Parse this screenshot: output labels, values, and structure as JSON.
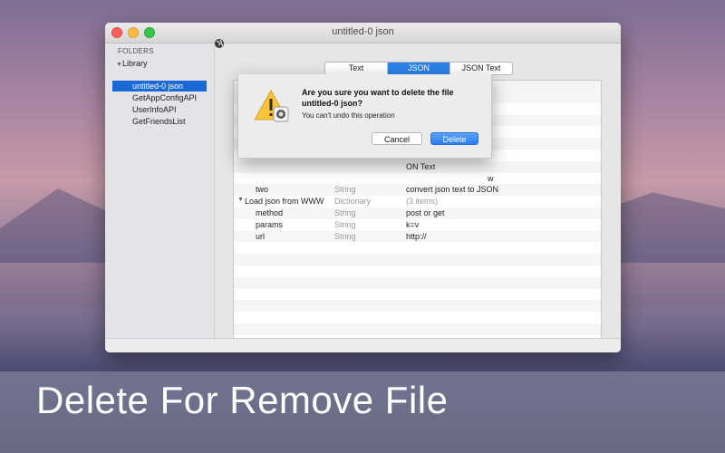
{
  "window": {
    "title": "untitled-0 json"
  },
  "sidebar": {
    "header": "FOLDERS",
    "library": "Library",
    "items": [
      {
        "label": "untitled-0 json",
        "selected": true
      },
      {
        "label": "GetAppConfigAPI",
        "selected": false
      },
      {
        "label": "UserInfoAPI",
        "selected": false
      },
      {
        "label": "GetFriendsList",
        "selected": false
      }
    ]
  },
  "tabs": [
    {
      "label": "Text",
      "active": false
    },
    {
      "label": "JSON",
      "active": true
    },
    {
      "label": "JSON Text",
      "active": false
    }
  ],
  "table": {
    "rows": [
      {
        "key": "two",
        "type": "String",
        "value": "convert json text to JSON",
        "indent": 2,
        "arrow": false,
        "value_gray": false
      },
      {
        "key": "Load json from WWW",
        "type": "Dictionary",
        "value": "(3 items)",
        "indent": 0,
        "arrow": true,
        "value_gray": true
      },
      {
        "key": "method",
        "type": "String",
        "value": "post or get",
        "indent": 2,
        "arrow": false,
        "value_gray": false
      },
      {
        "key": "params",
        "type": "String",
        "value": "k=v",
        "indent": 2,
        "arrow": false,
        "value_gray": false
      },
      {
        "key": "url",
        "type": "String",
        "value": "http://",
        "indent": 2,
        "arrow": false,
        "value_gray": false
      }
    ],
    "partial_behind_dialog": [
      "ON Text",
      "w"
    ]
  },
  "dialog": {
    "title": "Are you sure you want to delete the file untitled-0 json?",
    "message": "You can't undo this operation",
    "cancel_label": "Cancel",
    "delete_label": "Delete",
    "icon": "warning-icon"
  },
  "banner": {
    "text": "Delete For Remove File"
  },
  "colors": {
    "accent": "#2d82e8",
    "selection": "#1a69d6"
  }
}
